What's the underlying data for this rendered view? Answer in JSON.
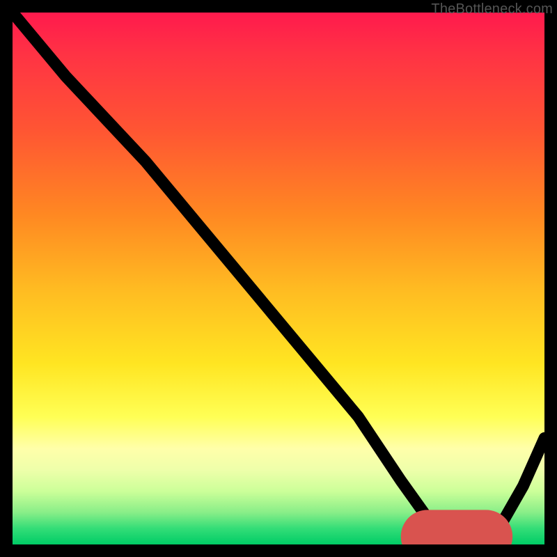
{
  "watermark": "TheBottleneck.com",
  "chart_data": {
    "type": "line",
    "title": "",
    "xlabel": "",
    "ylabel": "",
    "xlim": [
      0,
      100
    ],
    "ylim": [
      0,
      100
    ],
    "grid": false,
    "legend": false,
    "background_gradient": {
      "top": "#ff1a4d",
      "middle": "#ffe522",
      "bottom": "#00cc66"
    },
    "series": [
      {
        "name": "bottleneck-curve",
        "color": "#000000",
        "x": [
          0,
          10,
          25,
          35,
          45,
          55,
          65,
          73,
          78,
          81,
          84,
          88,
          92,
          96,
          100
        ],
        "y": [
          100,
          88,
          72,
          60,
          48,
          36,
          24,
          12,
          5,
          2,
          1,
          1,
          4,
          11,
          20
        ]
      }
    ],
    "markers": [
      {
        "name": "optimal-range",
        "color": "#d9534f",
        "x_start": 78,
        "x_end": 89,
        "y": 1.5
      }
    ]
  }
}
